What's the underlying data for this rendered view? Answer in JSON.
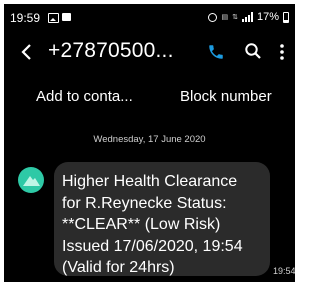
{
  "status_bar": {
    "time": "19:59",
    "battery": "17%"
  },
  "app_bar": {
    "contact_number": "+27870500..."
  },
  "actions": {
    "add_contact": "Add to conta...",
    "block_number": "Block number"
  },
  "conversation": {
    "date_separator": "Wednesday, 17 June 2020",
    "messages": [
      {
        "text": "Higher Health Clearance\nfor R.Reynecke Status:\n**CLEAR** (Low Risk)\nIssued 17/06/2020, 19:54\n(Valid for 24hrs)",
        "time": "19:54"
      }
    ]
  },
  "colors": {
    "background": "#000000",
    "bubble": "#2b2b2b",
    "accent": "#1c9be0",
    "avatar": "#2ec9a6"
  }
}
